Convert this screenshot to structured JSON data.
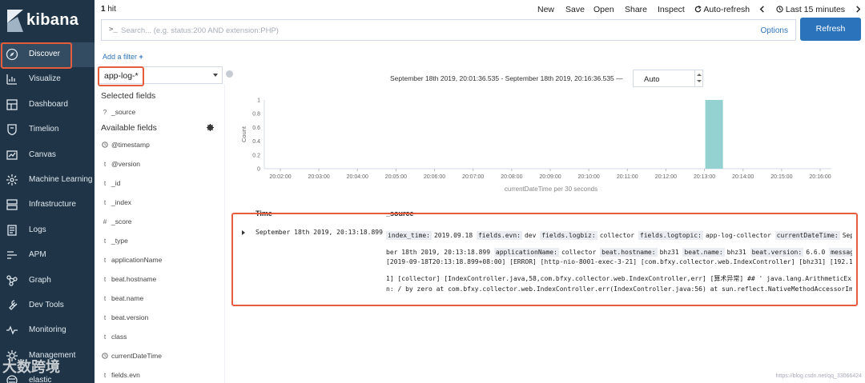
{
  "brand": {
    "name": "kibana"
  },
  "nav": [
    {
      "label": "Discover",
      "icon": "compass-icon",
      "active": true
    },
    {
      "label": "Visualize",
      "icon": "chart-icon"
    },
    {
      "label": "Dashboard",
      "icon": "dashboard-icon"
    },
    {
      "label": "Timelion",
      "icon": "shield-icon"
    },
    {
      "label": "Canvas",
      "icon": "canvas-icon"
    },
    {
      "label": "Machine Learning",
      "icon": "machine-learning-icon"
    },
    {
      "label": "Infrastructure",
      "icon": "infrastructure-icon"
    },
    {
      "label": "Logs",
      "icon": "logs-icon"
    },
    {
      "label": "APM",
      "icon": "apm-icon"
    },
    {
      "label": "Graph",
      "icon": "graph-icon"
    },
    {
      "label": "Dev Tools",
      "icon": "wrench-icon"
    },
    {
      "label": "Monitoring",
      "icon": "heartbeat-icon"
    },
    {
      "label": "Management",
      "icon": "gear-icon"
    },
    {
      "label": "elastic",
      "icon": "elastic-icon"
    }
  ],
  "topbar": {
    "hits_count": "1",
    "hits_label": "hit",
    "menu": [
      "New",
      "Save",
      "Open",
      "Share",
      "Inspect"
    ],
    "auto_refresh": "Auto-refresh",
    "time_picker": "Last 15 minutes"
  },
  "query": {
    "prompt": ">_",
    "placeholder": "Search... (e.g. status:200 AND extension:PHP)",
    "options": "Options",
    "refresh": "Refresh"
  },
  "filters": {
    "add_filter": "Add a filter"
  },
  "index_pattern": "app-log-*",
  "fields": {
    "selected_title": "Selected fields",
    "selected": [
      {
        "type": "?",
        "name": "_source"
      }
    ],
    "available_title": "Available fields",
    "available": [
      {
        "type": "clock",
        "name": "@timestamp"
      },
      {
        "type": "t",
        "name": "@version"
      },
      {
        "type": "t",
        "name": "_id"
      },
      {
        "type": "t",
        "name": "_index"
      },
      {
        "type": "#",
        "name": "_score"
      },
      {
        "type": "t",
        "name": "_type"
      },
      {
        "type": "t",
        "name": "applicationName"
      },
      {
        "type": "t",
        "name": "beat.hostname"
      },
      {
        "type": "t",
        "name": "beat.name"
      },
      {
        "type": "t",
        "name": "beat.version"
      },
      {
        "type": "t",
        "name": "class"
      },
      {
        "type": "clock",
        "name": "currentDateTime"
      },
      {
        "type": "t",
        "name": "fields.evn"
      }
    ]
  },
  "histogram": {
    "time_range": "September 18th 2019, 20:01:36.535 - September 18th 2019, 20:16:36.535 —",
    "interval": "Auto"
  },
  "chart_data": {
    "type": "bar",
    "ylabel": "Count",
    "xlabel": "currentDateTime per 30 seconds",
    "ylim": [
      0,
      1
    ],
    "yticks": [
      "0",
      "0.2",
      "0.4",
      "0.6",
      "0.8",
      "1"
    ],
    "xticks": [
      "20:02:00",
      "20:03:00",
      "20:04:00",
      "20:05:00",
      "20:06:00",
      "20:07:00",
      "20:08:00",
      "20:09:00",
      "20:10:00",
      "20:11:00",
      "20:12:00",
      "20:13:00",
      "20:14:00",
      "20:15:00",
      "20:16:00"
    ],
    "bars": [
      {
        "start": "20:13:00",
        "end": "20:13:30",
        "value": 1
      }
    ],
    "bar_color": "#93d2d0"
  },
  "doc_table": {
    "col_time": "Time",
    "col_source": "_source",
    "row": {
      "time": "September 18th 2019, 20:13:18.899",
      "line1": [
        [
          "index_time:",
          "2019.09.18"
        ],
        [
          "fields.evn:",
          "dev"
        ],
        [
          "fields.logbiz:",
          "collector"
        ],
        [
          "fields.logtopic:",
          "app-log-collector"
        ],
        [
          "currentDateTime:",
          "Septem"
        ]
      ],
      "line2_prefix": "ber 18th 2019, 20:13:18.899",
      "line2": [
        [
          "applicationName:",
          "collector"
        ],
        [
          "beat.hostname:",
          "bhz31"
        ],
        [
          "beat.name:",
          "bhz31"
        ],
        [
          "beat.version:",
          "6.6.0"
        ],
        [
          "message:",
          ""
        ]
      ],
      "line3": "[2019-09-18T20:13:18.899+08:00] [ERROR] [http-nio-8001-exec-3-21] [com.bfxy.collector.web.IndexController] [bhz31] [192.168.11.3",
      "line4": "1] [collector] [IndexController.java,58,com.bfxy.collector.web.IndexController,err] [算术异常] ## '  java.lang.ArithmeticExceptio",
      "line5": "n: / by zero at com.bfxy.collector.web.IndexController.err(IndexController.java:56) at sun.reflect.NativeMethodAccessorImpl.invo"
    }
  },
  "watermark": "大数跨境",
  "credit": "https://blog.csdn.net/qq_33066424"
}
